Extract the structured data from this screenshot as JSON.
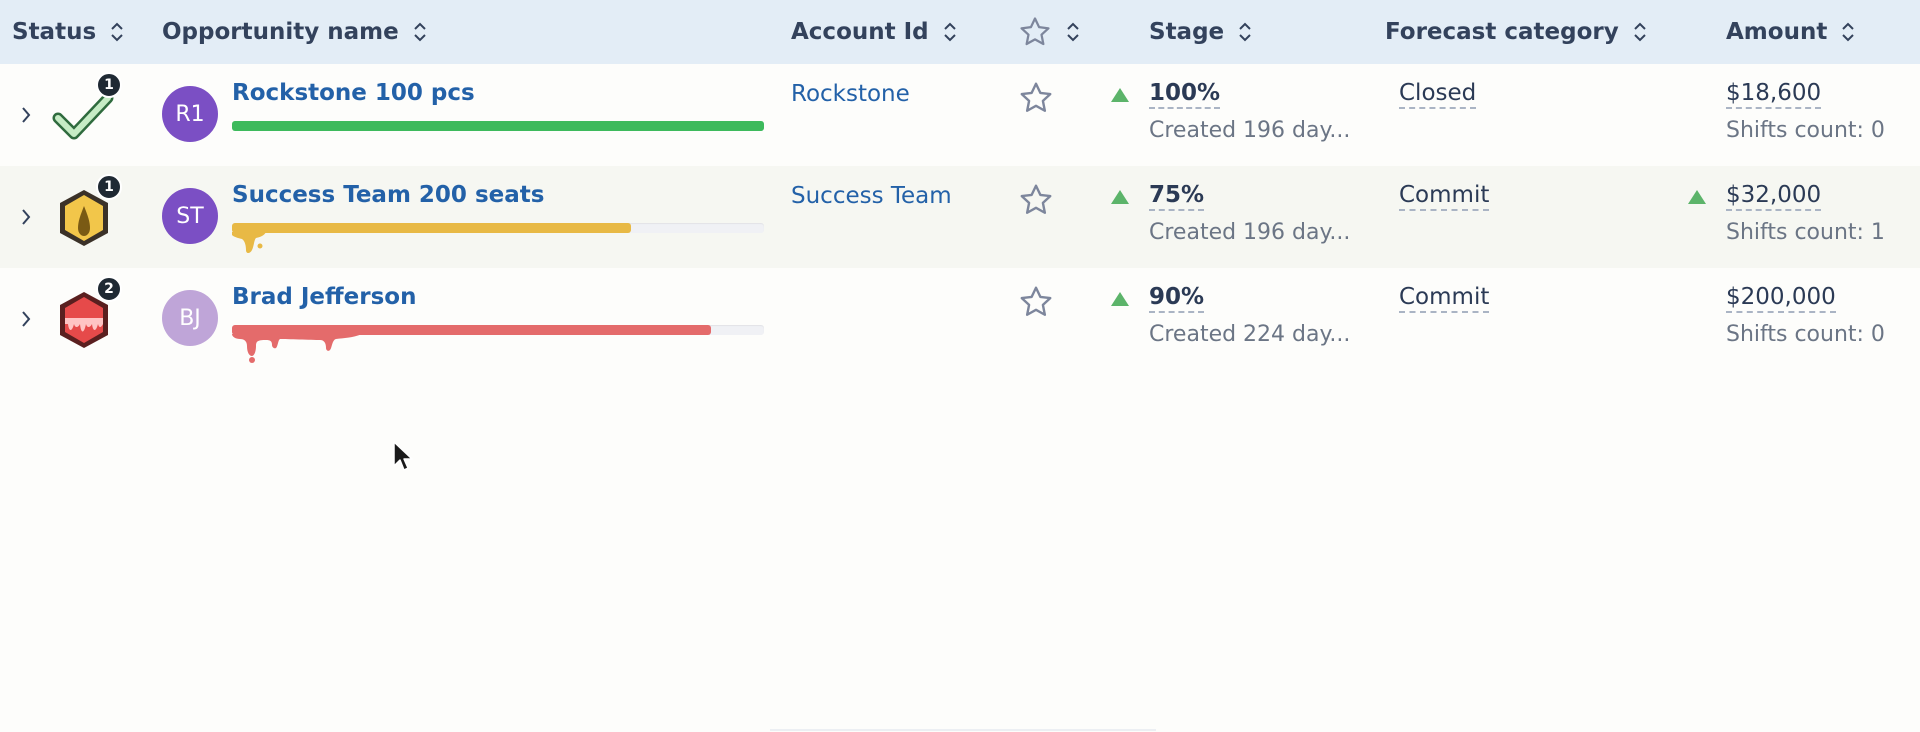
{
  "header": {
    "status": "Status",
    "opportunity_name": "Opportunity name",
    "account_id": "Account Id",
    "stage": "Stage",
    "forecast_category": "Forecast category",
    "amount": "Amount"
  },
  "rows": [
    {
      "status_count": "1",
      "status_icon": "green-check-icon",
      "avatar_initials": "R1",
      "avatar_color": "#7b4fc4",
      "opportunity": "Rockstone 100 pcs",
      "progress": 1.0,
      "progress_color": "#3dba5c",
      "account": "Rockstone",
      "stage": "100%",
      "created": "Created 196 day...",
      "forecast": "Closed",
      "amount": "$18,600",
      "shifts": "Shifts count: 0"
    },
    {
      "status_count": "1",
      "status_icon": "yellow-hexagon-drip-icon",
      "avatar_initials": "ST",
      "avatar_color": "#7b4fc4",
      "opportunity": "Success Team 200 seats",
      "progress": 0.75,
      "progress_color": "#e8b945",
      "account": "Success Team",
      "stage": "75%",
      "created": "Created 196 day...",
      "forecast": "Commit",
      "amount": "$32,000",
      "shifts": "Shifts count: 1"
    },
    {
      "status_count": "2",
      "status_icon": "red-hexagon-drip-icon",
      "avatar_initials": "BJ",
      "avatar_color": "#bfa5d8",
      "opportunity": "Brad Jefferson",
      "progress": 0.9,
      "progress_color": "#e46b6b",
      "account": "",
      "stage": "90%",
      "created": "Created 224 day...",
      "forecast": "Commit",
      "amount": "$200,000",
      "shifts": "Shifts count: 0"
    }
  ],
  "colors": {
    "header_bg": "#e3edf6",
    "link": "#2361a8",
    "trend_up": "#5cb46a"
  }
}
